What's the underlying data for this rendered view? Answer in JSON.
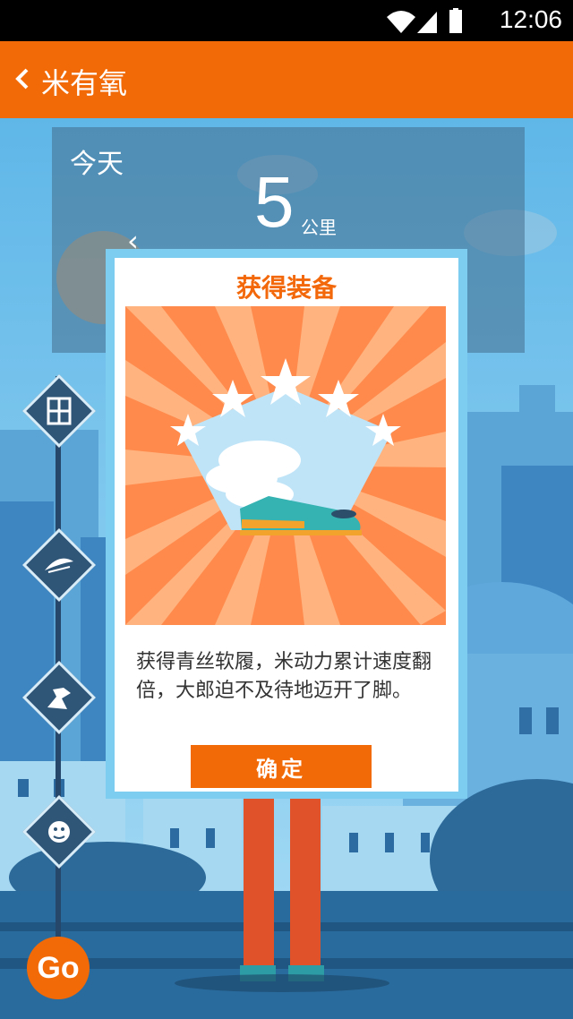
{
  "status_bar": {
    "time": "12:06",
    "icons": [
      "wifi-icon",
      "signal-icon",
      "battery-icon"
    ]
  },
  "app_bar": {
    "title": "米有氧",
    "back_icon": "chevron-left-icon"
  },
  "today_panel": {
    "label": "今天",
    "distance_value": "5",
    "distance_unit": "公里"
  },
  "sidebar": {
    "items": [
      {
        "icon": "door-icon"
      },
      {
        "icon": "wing-icon"
      },
      {
        "icon": "sprint-icon"
      },
      {
        "icon": "beast-icon"
      }
    ],
    "go_label": "Go"
  },
  "dialog": {
    "title": "获得装备",
    "message": "获得青丝软履，米动力累计速度翻倍，大郎迫不及待地迈开了脚。",
    "confirm_label": "确定",
    "image_icon": "winged-shoe-icon"
  },
  "colors": {
    "accent": "#f26a08",
    "sky": "#6cc0ea",
    "dark_blue": "#2f5577"
  }
}
